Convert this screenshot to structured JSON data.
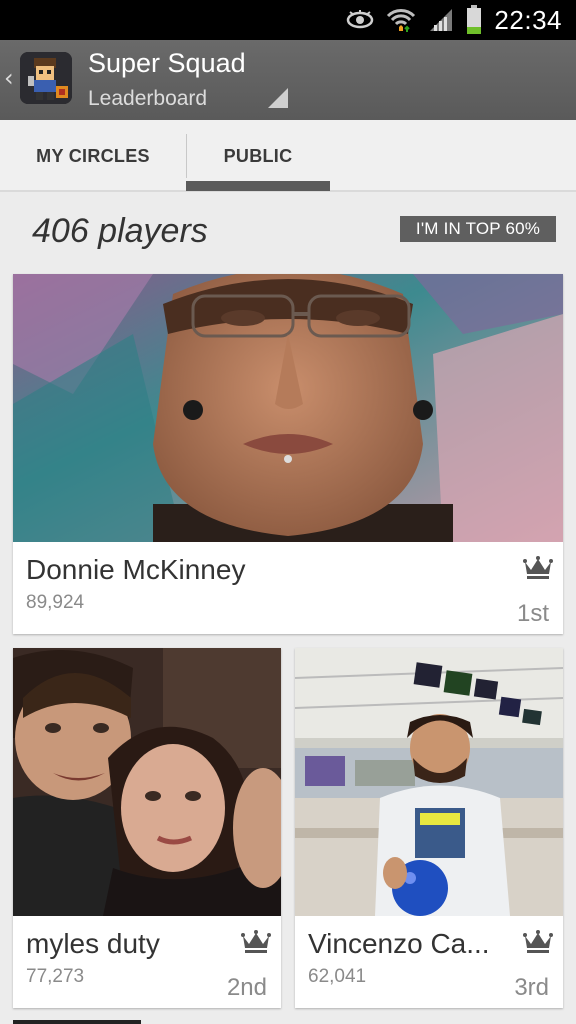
{
  "status_bar": {
    "time": "22:34",
    "icons": [
      "eye-icon",
      "wifi-icon",
      "signal-icon",
      "battery-icon"
    ]
  },
  "action_bar": {
    "title": "Super Squad",
    "subtitle": "Leaderboard"
  },
  "tabs": [
    {
      "label": "MY CIRCLES",
      "selected": false
    },
    {
      "label": "PUBLIC",
      "selected": true
    }
  ],
  "summary": {
    "players_count": "406 players",
    "badge": "I'M IN TOP 60%"
  },
  "leaderboard": [
    {
      "name": "Donnie McKinney",
      "score": "89,924",
      "rank": "1st"
    },
    {
      "name": "myles duty",
      "score": "77,273",
      "rank": "2nd"
    },
    {
      "name": "Vincenzo Ca...",
      "score": "62,041",
      "rank": "3rd"
    }
  ],
  "colors": {
    "actionbar": "#5f5f5f",
    "tab_indicator": "#5a5a5a",
    "badge": "#5f5f5f",
    "background": "#ececec"
  }
}
